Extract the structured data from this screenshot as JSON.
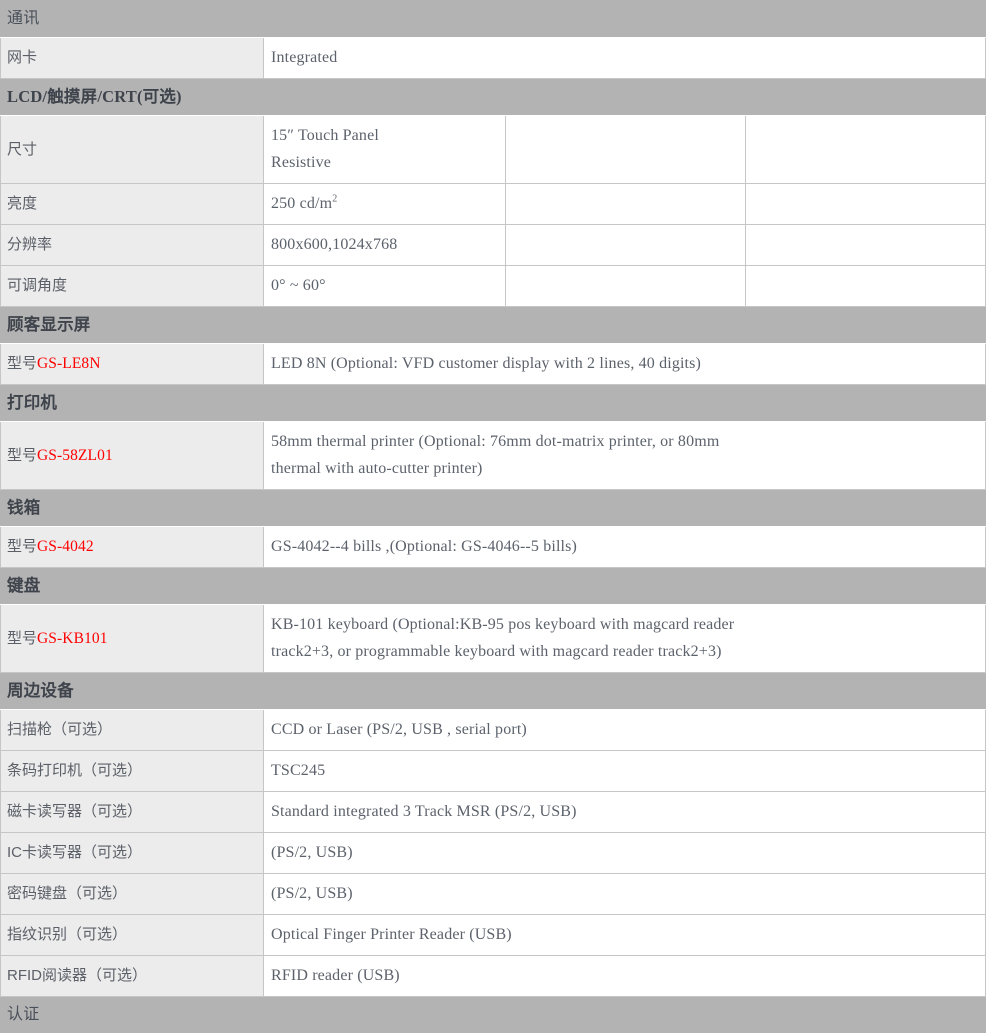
{
  "colors": {
    "section_header_bg": "#b3b3b3",
    "label_cell_bg": "#ececec",
    "value_cell_bg": "#ffffff",
    "border": "#c6c6c6",
    "text": "#5c626b",
    "model_red": "#ff0000"
  },
  "table": {
    "columns": 4,
    "rows": [
      {
        "type": "section",
        "title": "通讯",
        "bold": false
      },
      {
        "type": "data",
        "label": "网卡",
        "value": [
          "Integrated"
        ],
        "span": 3
      },
      {
        "type": "section",
        "title": "LCD/触摸屏/CRT(可选)",
        "bold": true
      },
      {
        "type": "data",
        "label": "尺寸",
        "value": [
          "15″ Touch Panel",
          "Resistive"
        ],
        "span": 1,
        "extra_cells": 2
      },
      {
        "type": "data",
        "label": "亮度",
        "value": [
          "250 cd/m2"
        ],
        "value_html": "250 cd/m<sup>2</sup>",
        "span": 1,
        "extra_cells": 2
      },
      {
        "type": "data",
        "label": "分辨率",
        "value": [
          "800x600,1024x768"
        ],
        "span": 1,
        "extra_cells": 2
      },
      {
        "type": "data",
        "label": "可调角度",
        "value": [
          "0°  ~ 60°"
        ],
        "span": 1,
        "extra_cells": 2
      },
      {
        "type": "section",
        "title": "顾客显示屏",
        "bold": true
      },
      {
        "type": "data",
        "label": "型号",
        "model": "GS-LE8N",
        "value": [
          "LED 8N (Optional: VFD customer display with 2 lines, 40 digits)"
        ],
        "span": 3
      },
      {
        "type": "section",
        "title": "打印机",
        "bold": true
      },
      {
        "type": "data",
        "label": "型号",
        "model": "GS-58ZL01",
        "value": [
          "58mm thermal printer (Optional: 76mm dot-matrix printer, or 80mm",
          "thermal with auto-cutter printer)"
        ],
        "span": 3
      },
      {
        "type": "section",
        "title": "钱箱",
        "bold": true
      },
      {
        "type": "data",
        "label": "型号",
        "model": "GS-4042",
        "value": [
          "GS-4042--4 bills ,(Optional: GS-4046--5 bills)"
        ],
        "span": 3
      },
      {
        "type": "section",
        "title": "键盘",
        "bold": true
      },
      {
        "type": "data",
        "label": "型号",
        "model": "GS-KB101",
        "value": [
          "KB-101 keyboard (Optional:KB-95 pos keyboard with magcard reader",
          "track2+3, or programmable keyboard with magcard reader track2+3)"
        ],
        "span": 3
      },
      {
        "type": "section",
        "title": "周边设备",
        "bold": true
      },
      {
        "type": "data",
        "label": "扫描枪（可选）",
        "value": [
          "CCD or Laser (PS/2, USB , serial port)"
        ],
        "span": 3
      },
      {
        "type": "data",
        "label": "条码打印机（可选）",
        "value": [
          "TSC245"
        ],
        "span": 3
      },
      {
        "type": "data",
        "label": "磁卡读写器（可选）",
        "value": [
          "Standard integrated 3 Track MSR (PS/2, USB)"
        ],
        "span": 3
      },
      {
        "type": "data",
        "label": "IC卡读写器（可选）",
        "value": [
          "(PS/2, USB)"
        ],
        "span": 3
      },
      {
        "type": "data",
        "label": "密码键盘（可选）",
        "value": [
          "(PS/2, USB)"
        ],
        "span": 3
      },
      {
        "type": "data",
        "label": "指纹识别（可选）",
        "value": [
          "Optical Finger Printer Reader (USB)"
        ],
        "span": 3
      },
      {
        "type": "data",
        "label": "RFID阅读器（可选）",
        "value": [
          "RFID reader (USB)"
        ],
        "span": 3
      },
      {
        "type": "section",
        "title": "认证",
        "bold": false
      }
    ]
  }
}
